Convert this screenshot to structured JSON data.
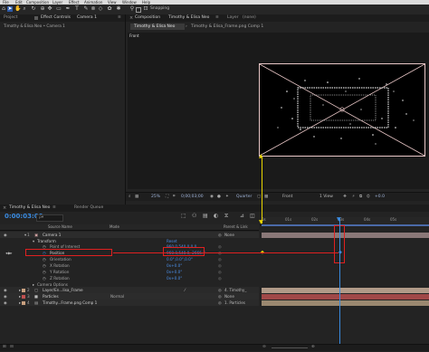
{
  "menu": [
    "File",
    "Edit",
    "Composition",
    "Layer",
    "Effect",
    "Animation",
    "View",
    "Window",
    "Help"
  ],
  "toolbar": {
    "snapping": "Snapping"
  },
  "left_panel": {
    "tab_project": "Project",
    "tab_effects": "Effect Controls",
    "tab_effects_target": "Camera 1",
    "breadcrumb": "Timothy & Elisa Neo • Camera 1"
  },
  "comp_panel": {
    "tab_composition": "Composition",
    "comp_name": "Timothy & Elisa Neo",
    "tab_layer": "Layer",
    "layer_tab_value": "(none)",
    "subtab_active": "Timothy & Elisa Neo",
    "subtab_other": "Timothy & Elisa_Frame.png Comp 1",
    "view_label": "Front",
    "zoom": "25%",
    "time": "0;00;03;00",
    "resolution": "Quarter",
    "view_select": "Front",
    "views": "1 View",
    "offset": "+0.0"
  },
  "timeline": {
    "tab_active": "Timothy & Elisa Neo",
    "tab_render": "Render Queue",
    "timecode": "0:00:03:00",
    "search_placeholder": "ρ▾",
    "col_source": "Source Name",
    "col_mode": "Mode",
    "col_parent": "Parent & Link",
    "rows": [
      {
        "name": "Camera 1",
        "value": "",
        "parent": "None",
        "num": "1"
      },
      {
        "name": "Transform",
        "value": "Reset",
        "parent": "",
        "num": ""
      },
      {
        "name": "Point of Interest",
        "value": "960.0,540.0,0.0",
        "parent": "",
        "num": ""
      },
      {
        "name": "Position",
        "value": "960.0,540.0,-2666.7",
        "parent": "",
        "num": ""
      },
      {
        "name": "Orientation",
        "value": "0.0°,0.0°,0.0°",
        "parent": "",
        "num": ""
      },
      {
        "name": "X Rotation",
        "value": "0x+0.0°",
        "parent": "",
        "num": ""
      },
      {
        "name": "Y Rotation",
        "value": "0x+0.0°",
        "parent": "",
        "num": ""
      },
      {
        "name": "Z Rotation",
        "value": "0x+0.0°",
        "parent": "",
        "num": ""
      },
      {
        "name": "Camera Options",
        "value": "",
        "parent": "",
        "num": ""
      },
      {
        "name": "Layer/En...lisa_Frame",
        "value": "",
        "parent": "4. Timothy_",
        "num": "2"
      },
      {
        "name": "Particles",
        "value": "Normal",
        "parent": "None",
        "num": "3"
      },
      {
        "name": "Timothy...Frame.png Comp 1",
        "value": "",
        "parent": "1. Particles",
        "num": "4"
      }
    ],
    "ruler": [
      "0s",
      "01s",
      "02s",
      "03s",
      "04s",
      "05s"
    ]
  },
  "colors": {
    "accent": "#2d5aa8",
    "timecode": "#3a8be0",
    "highlight": "#e02020",
    "playhead": "#e8d400"
  }
}
